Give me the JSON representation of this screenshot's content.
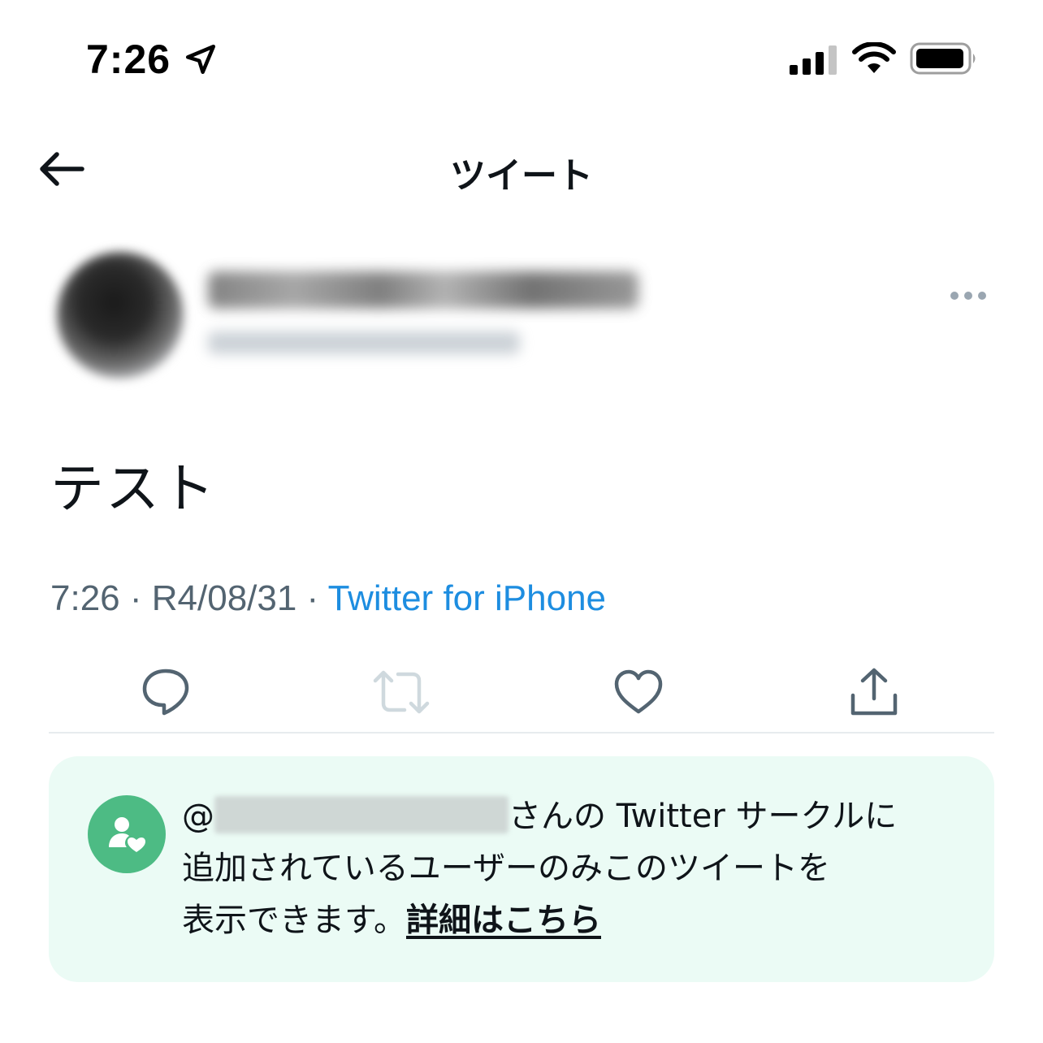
{
  "status_bar": {
    "time": "7:26"
  },
  "nav": {
    "title": "ツイート"
  },
  "tweet": {
    "text": "テスト",
    "time": "7:26",
    "separator": " · ",
    "date": "R4/08/31",
    "source": "Twitter for iPhone"
  },
  "circle_notice": {
    "at": "@",
    "text_part1": "さんの Twitter サークルに",
    "text_part2": "追加されているユーザーのみこのツイートを",
    "text_part3": "表示できます。",
    "link_label": "詳細はこちら"
  },
  "colors": {
    "link": "#1d8de0",
    "circle_green": "#4dbb84",
    "notice_bg": "#ebfbf5",
    "muted": "#536471"
  },
  "icons": [
    "location-arrow-icon",
    "signal-icon",
    "wifi-icon",
    "battery-icon",
    "back-arrow-icon",
    "more-icon",
    "reply-icon",
    "retweet-icon",
    "like-icon",
    "share-icon",
    "circle-icon"
  ]
}
